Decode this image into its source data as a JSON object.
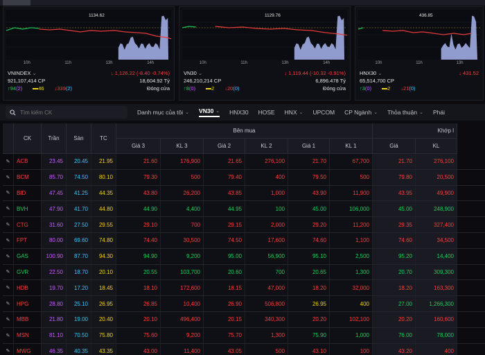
{
  "tabs": [
    "",
    "",
    "",
    "",
    "",
    "",
    "",
    "",
    ""
  ],
  "indices": [
    {
      "name": "VNINDEX",
      "peak": "1134.62",
      "change": "1,126.22 (-8.40 -0.74%)",
      "volume": "921,107,414 CP",
      "value": "18,604.92 Tỷ",
      "up": "94",
      "up_ceiling": "(2)",
      "flat": "46",
      "down": "339",
      "down_floor": "(2)",
      "status": "Đóng cửa",
      "times": [
        "10h",
        "11h",
        "13h",
        "14h"
      ]
    },
    {
      "name": "VN30",
      "peak": "1129.76",
      "change": "1,119.44 (-10.32 -0.91%)",
      "volume": "246,210,214 CP",
      "value": "6,896.478 Tỷ",
      "up": "8",
      "up_ceiling": "(0)",
      "flat": "2",
      "down": "20",
      "down_floor": "(0)",
      "status": "Đóng cửa",
      "times": [
        "10h",
        "11h",
        "13h",
        "14h"
      ]
    },
    {
      "name": "HNX30",
      "peak": "436.85",
      "change": "431.52",
      "volume": "65,514,700 CP",
      "value": "",
      "up": "3",
      "up_ceiling": "(0)",
      "flat": "2",
      "down": "21",
      "down_floor": "(0)",
      "status": "",
      "times": [
        "10h",
        "11h",
        "13h"
      ]
    }
  ],
  "filter": {
    "search_placeholder": "Tìm kiếm CK",
    "items": [
      {
        "label": "Danh mục của tôi",
        "dropdown": true
      },
      {
        "label": "VN30",
        "dropdown": true,
        "active": true
      },
      {
        "label": "HNX30",
        "dropdown": false
      },
      {
        "label": "HOSE",
        "dropdown": false
      },
      {
        "label": "HNX",
        "dropdown": true
      },
      {
        "label": "UPCOM",
        "dropdown": false
      },
      {
        "label": "CP Ngành",
        "dropdown": true
      },
      {
        "label": "Thỏa thuận",
        "dropdown": true
      },
      {
        "label": "Phái",
        "dropdown": false
      }
    ]
  },
  "table": {
    "headers": {
      "ck": "CK",
      "tran": "Trần",
      "san": "Sàn",
      "tc": "TC",
      "ben_mua": "Bên mua",
      "khop": "Khớp l",
      "gia3": "Giá 3",
      "kl3": "KL 3",
      "gia2": "Giá 2",
      "kl2": "KL 2",
      "gia1": "Giá 1",
      "kl1": "KL 1",
      "gia": "Giá",
      "kl": "KL"
    },
    "rows": [
      {
        "ck": "ACB",
        "tran": "23.45",
        "san": "20.45",
        "tc": "21.95",
        "g3": "21.60",
        "k3": "176,900",
        "g2": "21.65",
        "k2": "276,100",
        "g1": "21.70",
        "k1": "67,700",
        "g": "21.70",
        "k": "276,100",
        "c": "red",
        "cg1": "red"
      },
      {
        "ck": "BCM",
        "tran": "85.70",
        "san": "74.50",
        "tc": "80.10",
        "g3": "79.30",
        "k3": "500",
        "g2": "79.40",
        "k2": "400",
        "g1": "79.50",
        "k1": "500",
        "g": "79.80",
        "k": "20,500",
        "c": "red",
        "cg1": "red"
      },
      {
        "ck": "BID",
        "tran": "47.45",
        "san": "41.25",
        "tc": "44.35",
        "g3": "43.80",
        "k3": "26,200",
        "g2": "43.85",
        "k2": "1,000",
        "g1": "43.90",
        "k1": "11,900",
        "g": "43.95",
        "k": "49,900",
        "c": "red",
        "cg1": "red"
      },
      {
        "ck": "BVH",
        "tran": "47.90",
        "san": "41.70",
        "tc": "44.80",
        "g3": "44.90",
        "k3": "4,400",
        "g2": "44.95",
        "k2": "100",
        "g1": "45.00",
        "k1": "106,000",
        "g": "45.00",
        "k": "248,900",
        "c": "green",
        "cg1": "green"
      },
      {
        "ck": "CTG",
        "tran": "31.60",
        "san": "27.50",
        "tc": "29.55",
        "g3": "29.10",
        "k3": "700",
        "g2": "29.15",
        "k2": "2,000",
        "g1": "29.20",
        "k1": "11,200",
        "g": "29.35",
        "k": "327,400",
        "c": "red",
        "cg1": "red"
      },
      {
        "ck": "FPT",
        "tran": "80.00",
        "san": "69.60",
        "tc": "74.80",
        "g3": "74.40",
        "k3": "30,500",
        "g2": "74.50",
        "k2": "17,600",
        "g1": "74.60",
        "k1": "1,100",
        "g": "74.60",
        "k": "34,500",
        "c": "red",
        "cg1": "red"
      },
      {
        "ck": "GAS",
        "tran": "100.90",
        "san": "87.70",
        "tc": "94.30",
        "g3": "94.90",
        "k3": "9,200",
        "g2": "95.00",
        "k2": "56,900",
        "g1": "95.10",
        "k1": "2,500",
        "g": "95.20",
        "k": "14,400",
        "c": "green",
        "cg1": "green"
      },
      {
        "ck": "GVR",
        "tran": "22.50",
        "san": "18.70",
        "tc": "20.10",
        "g3": "20.55",
        "k3": "103,700",
        "g2": "20.60",
        "k2": "700",
        "g1": "20.65",
        "k1": "1,300",
        "g": "20.70",
        "k": "309,300",
        "c": "green",
        "cg1": "green"
      },
      {
        "ck": "HDB",
        "tran": "19.70",
        "san": "17.20",
        "tc": "18.45",
        "g3": "18.10",
        "k3": "172,600",
        "g2": "18.15",
        "k2": "47,000",
        "g1": "18.20",
        "k1": "32,000",
        "g": "18.20",
        "k": "163,300",
        "c": "red",
        "cg1": "red"
      },
      {
        "ck": "HPG",
        "tran": "28.80",
        "san": "25.10",
        "tc": "26.95",
        "g3": "26.85",
        "k3": "10,400",
        "g2": "26.90",
        "k2": "506,800",
        "g1": "26.95",
        "k1": "400",
        "g": "27.00",
        "k": "1,266,300",
        "c": "red",
        "cg1": "yellow"
      },
      {
        "ck": "MBB",
        "tran": "21.80",
        "san": "19.00",
        "tc": "20.40",
        "g3": "20.10",
        "k3": "496,400",
        "g2": "20.15",
        "k2": "340,300",
        "g1": "20.20",
        "k1": "102,100",
        "g": "20.20",
        "k": "160,600",
        "c": "red",
        "cg1": "red"
      },
      {
        "ck": "MSN",
        "tran": "81.10",
        "san": "70.50",
        "tc": "75.80",
        "g3": "75.60",
        "k3": "9,200",
        "g2": "75.70",
        "k2": "1,300",
        "g1": "75.90",
        "k1": "1,000",
        "g": "76.00",
        "k": "78,000",
        "c": "red",
        "cg1": "green"
      },
      {
        "ck": "MWG",
        "tran": "46.35",
        "san": "40.35",
        "tc": "43.35",
        "g3": "43.00",
        "k3": "11,400",
        "g2": "43.05",
        "k2": "500",
        "g1": "43.10",
        "k1": "100",
        "g": "43.20",
        "k": "400",
        "c": "red",
        "cg1": "red"
      }
    ]
  },
  "colors": {
    "up": "#18d05a",
    "down": "#ff3b3b",
    "ref": "#f2d31b",
    "ceiling": "#c65bff",
    "floor": "#37c6ff"
  }
}
